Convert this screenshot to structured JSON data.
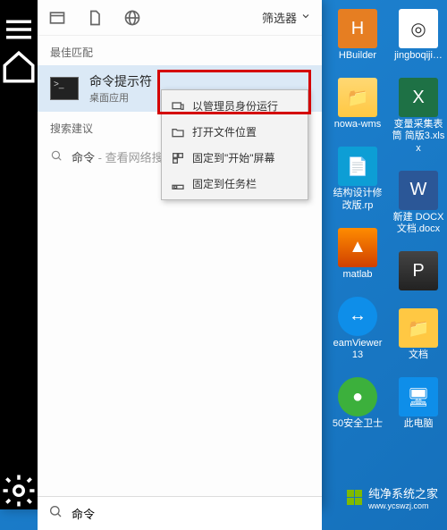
{
  "filter": {
    "label": "筛选器"
  },
  "sections": {
    "best_match": "最佳匹配",
    "suggestions": "搜索建议"
  },
  "best_match": {
    "title": "命令提示符",
    "subtitle": "桌面应用"
  },
  "suggestion": {
    "term": "命令",
    "hint": " - 查看网络搜"
  },
  "context_menu": {
    "run_admin": "以管理员身份运行",
    "open_location": "打开文件位置",
    "pin_start": "固定到\"开始\"屏幕",
    "pin_taskbar": "固定到任务栏"
  },
  "search": {
    "placeholder": "命令提示符",
    "value": "命令"
  },
  "desktop": {
    "col1": [
      {
        "name": "hbuilder",
        "label": "HBuilder",
        "cls": "ic-hbuilder",
        "glyph": "H"
      },
      {
        "name": "folder1",
        "label": "nowa-wms",
        "cls": "ic-folder",
        "glyph": "📁"
      },
      {
        "name": "rp1",
        "label": "结构设计修改版.rp",
        "cls": "ic-rp",
        "glyph": "📄"
      },
      {
        "name": "matlab",
        "label": "matlab",
        "cls": "ic-matlab",
        "glyph": "▲"
      },
      {
        "name": "teamviewer",
        "label": "eamViewer 13",
        "cls": "ic-teamviewer",
        "glyph": "↔"
      },
      {
        "name": "360",
        "label": "50安全卫士",
        "cls": "ic-360",
        "glyph": "●"
      }
    ],
    "col2": [
      {
        "name": "jing",
        "label": "jingboqiji…",
        "cls": "ic-jing",
        "glyph": "◎"
      },
      {
        "name": "xlsx",
        "label": "变量采集表筒 简版3.xlsx",
        "cls": "ic-excel",
        "glyph": "X"
      },
      {
        "name": "docx",
        "label": "新建 DOCX 文档.docx",
        "cls": "ic-word",
        "glyph": "W"
      },
      {
        "name": "ppt",
        "label": "",
        "cls": "ic-ppt",
        "glyph": "P"
      },
      {
        "name": "docs",
        "label": "文档",
        "cls": "ic-docs",
        "glyph": "📁"
      },
      {
        "name": "thispc",
        "label": "此电脑",
        "cls": "ic-pc",
        "glyph": "🖥"
      }
    ]
  },
  "watermark": {
    "text": "纯净系统之家",
    "url": "www.ycswzj.com"
  }
}
